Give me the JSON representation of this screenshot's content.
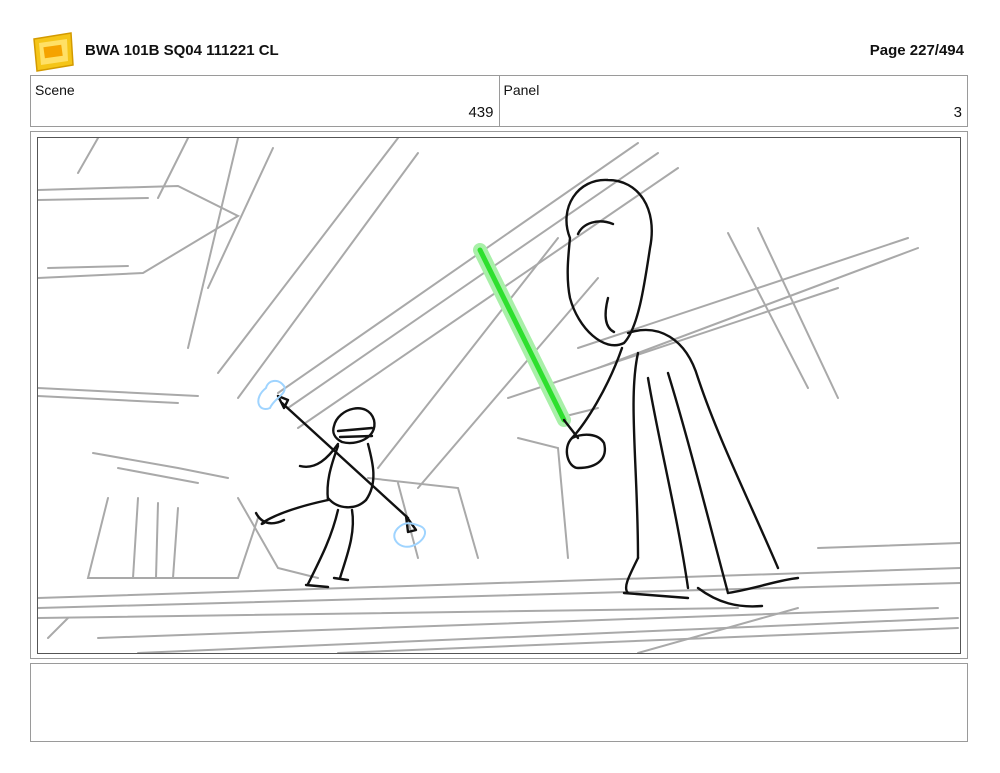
{
  "header": {
    "title": "BWA 101B SQ04 111221 CL",
    "page": "Page 227/494"
  },
  "scene": {
    "label": "Scene",
    "value": "439"
  },
  "panel": {
    "label": "Panel",
    "value": "3"
  },
  "notes": {
    "text": ""
  },
  "colors": {
    "saber": "#2ee02e",
    "ice": "#9fd4ff",
    "sketch": "#a9a9a9",
    "ink": "#111111"
  }
}
